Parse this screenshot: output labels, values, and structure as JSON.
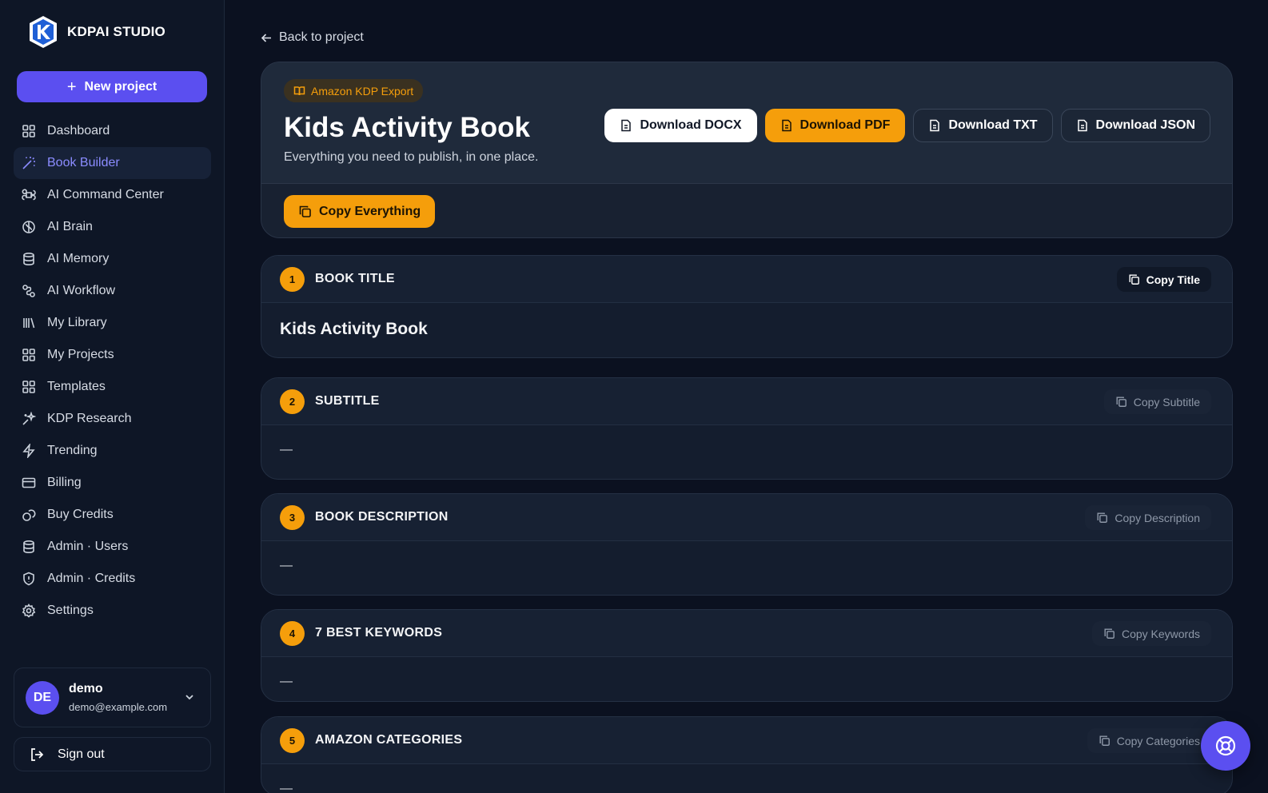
{
  "brand": {
    "name": "KDPAI STUDIO"
  },
  "sidebar": {
    "new_project": "New project",
    "items": [
      {
        "label": "Dashboard",
        "icon": "grid-icon"
      },
      {
        "label": "Book Builder",
        "icon": "wand-icon",
        "active": true
      },
      {
        "label": "AI Command Center",
        "icon": "command-icon"
      },
      {
        "label": "AI Brain",
        "icon": "brain-icon"
      },
      {
        "label": "AI Memory",
        "icon": "database-icon"
      },
      {
        "label": "AI Workflow",
        "icon": "workflow-icon"
      },
      {
        "label": "My Library",
        "icon": "library-icon"
      },
      {
        "label": "My Projects",
        "icon": "grid-icon"
      },
      {
        "label": "Templates",
        "icon": "grid-icon"
      },
      {
        "label": "KDP Research",
        "icon": "sparkles-icon"
      },
      {
        "label": "Trending",
        "icon": "zap-icon"
      },
      {
        "label": "Billing",
        "icon": "credit-card-icon"
      },
      {
        "label": "Buy Credits",
        "icon": "coins-icon"
      },
      {
        "label": "Admin · Users",
        "icon": "database-icon"
      },
      {
        "label": "Admin · Credits",
        "icon": "shield-icon"
      },
      {
        "label": "Settings",
        "icon": "gear-icon"
      }
    ],
    "user": {
      "initials": "DE",
      "name": "demo",
      "email": "demo@example.com"
    },
    "sign_out": "Sign out"
  },
  "main": {
    "back_link": "Back to project",
    "hero": {
      "badge": "Amazon KDP Export",
      "title": "Kids Activity Book",
      "subtitle": "Everything you need to publish, in one place.",
      "downloads": {
        "docx": "Download DOCX",
        "pdf": "Download PDF",
        "txt": "Download TXT",
        "json": "Download JSON"
      },
      "copy_all": "Copy Everything"
    },
    "sections": [
      {
        "num": "1",
        "label": "BOOK TITLE",
        "copy": "Copy Title",
        "value": "Kids Activity Book"
      },
      {
        "num": "2",
        "label": "SUBTITLE",
        "copy": "Copy Subtitle",
        "value": "—"
      },
      {
        "num": "3",
        "label": "BOOK DESCRIPTION",
        "copy": "Copy Description",
        "value": "—"
      },
      {
        "num": "4",
        "label": "7 BEST KEYWORDS",
        "copy": "Copy Keywords",
        "value": "—"
      },
      {
        "num": "5",
        "label": "AMAZON CATEGORIES",
        "copy": "Copy Categories",
        "value": "—"
      }
    ]
  },
  "colors": {
    "accent": "#5b4ff0",
    "orange": "#f59e0b",
    "background": "#0b1120"
  }
}
